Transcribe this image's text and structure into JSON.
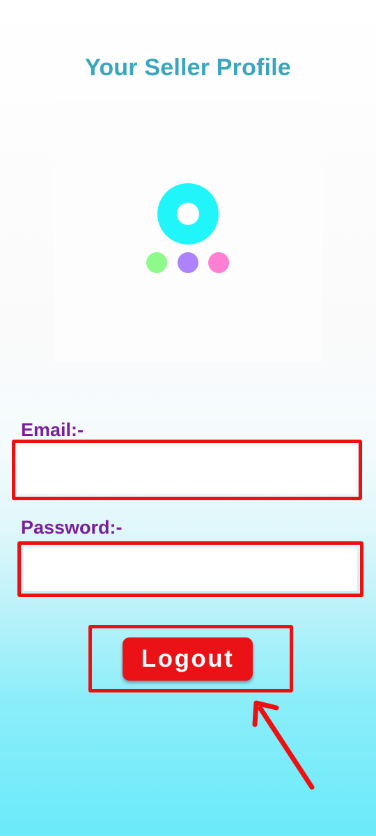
{
  "header": {
    "title": "Your Seller Profile"
  },
  "logo": {
    "icon": "app-logo-icon",
    "ring_color": "#20f5fa",
    "dot_colors": [
      "#8efa8c",
      "#ad82fb",
      "#ff7fd3"
    ]
  },
  "form": {
    "email_label": "Email:-",
    "email_value": "",
    "password_label": "Password:-",
    "password_value": "",
    "logout_label": "Logout"
  },
  "annotation": {
    "highlight_color": "#ee0f10",
    "arrow_icon": "arrow-pointer-icon"
  },
  "colors": {
    "title": "#3aa6bd",
    "label": "#7a1f99",
    "button": "#ea1216"
  }
}
